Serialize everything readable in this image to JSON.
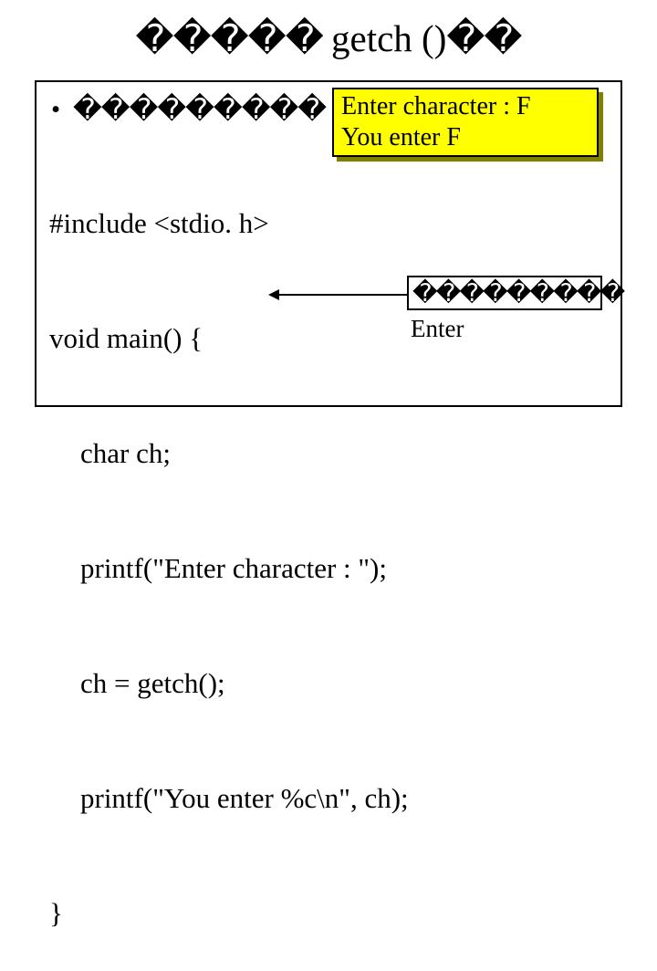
{
  "title": {
    "boxes_left": "����� ",
    "fn": "getch ()",
    "boxes_right": "��"
  },
  "bullet": "•",
  "bullet_boxes": "���������",
  "code": {
    "l1": "#include <stdio. h>",
    "l2": "void main() {",
    "l3": "char ch;",
    "l4": "printf(\"Enter character : \");",
    "l5": "ch = getch();",
    "l6_left": "printf(\"You enter %c\\n\", ch);",
    "l7": "}"
  },
  "output_box": {
    "line1": "Enter character : F",
    "line2": "You enter F"
  },
  "side_box": "���������",
  "enter_label": "Enter"
}
